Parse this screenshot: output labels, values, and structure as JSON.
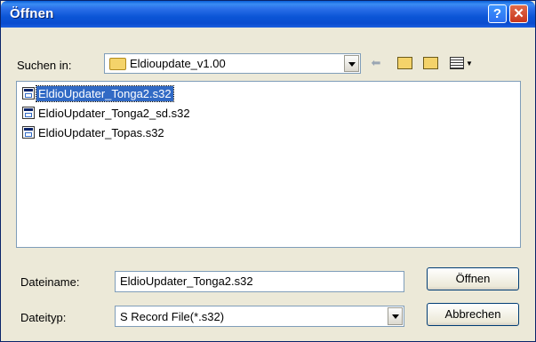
{
  "window": {
    "title": "Öffnen",
    "help_label": "?",
    "close_label": "✕"
  },
  "lookin": {
    "label": "Suchen in:",
    "value": "Eldioupdate_v1.00"
  },
  "toolbar": {
    "back_icon": "back-arrow-icon",
    "up_icon": "up-folder-icon",
    "newfolder_icon": "new-folder-icon",
    "view_icon": "view-menu-icon"
  },
  "files": [
    {
      "name": "EldioUpdater_Tonga2.s32",
      "selected": true
    },
    {
      "name": "EldioUpdater_Tonga2_sd.s32",
      "selected": false
    },
    {
      "name": "EldioUpdater_Topas.s32",
      "selected": false
    }
  ],
  "filename": {
    "label": "Dateiname:",
    "value": "EldioUpdater_Tonga2.s32"
  },
  "filetype": {
    "label": "Dateityp:",
    "value": "S Record File(*.s32)"
  },
  "buttons": {
    "open": "Öffnen",
    "cancel": "Abbrechen"
  },
  "colors": {
    "titlebar": "#0b55d6",
    "selection": "#316ac5",
    "dialog_bg": "#ece9d8"
  }
}
